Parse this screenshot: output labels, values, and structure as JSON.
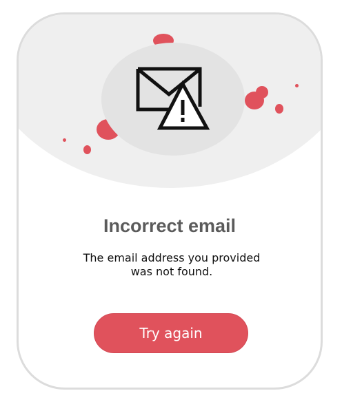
{
  "colors": {
    "accent": "#e0525c",
    "hero_background": "#efefef",
    "icon_circle": "#e3e3e3",
    "title_text": "#5b5b5b",
    "card_border": "#dcdcdc"
  },
  "hero": {
    "icon": "mail-warning-icon"
  },
  "dialog": {
    "title": "Incorrect email",
    "message": "The email address you provided was not found.",
    "button_label": "Try again"
  }
}
